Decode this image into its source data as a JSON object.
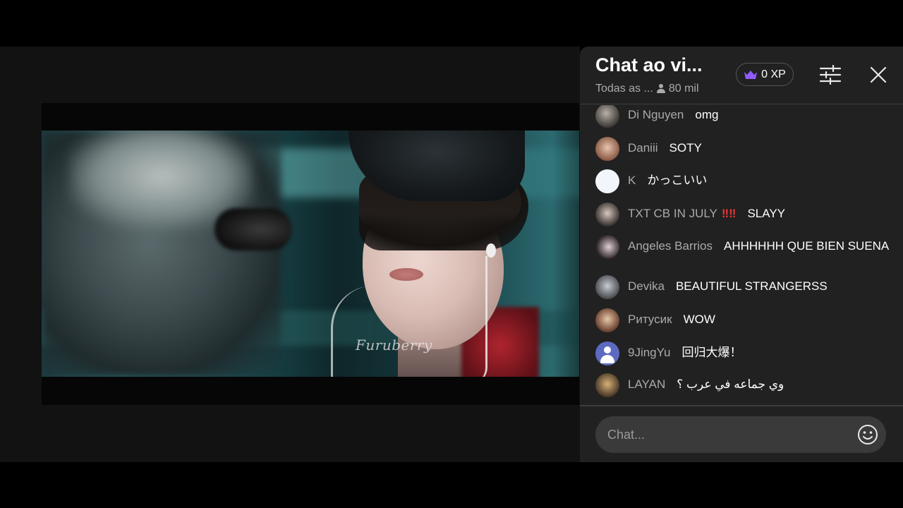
{
  "video": {
    "watermark": "Furuberry"
  },
  "chat": {
    "title": "Chat ao vi...",
    "filter_label": "Todas as ...",
    "viewer_count": "80 mil",
    "xp_label": "0 XP",
    "input_placeholder": "Chat...",
    "messages": [
      {
        "author": "Di Nguyen",
        "text": "omg"
      },
      {
        "author": "Daniii",
        "text": "SOTY"
      },
      {
        "author": "K",
        "text": "かっこいい"
      },
      {
        "author": "TXT CB IN JULY",
        "badge": "‼‼",
        "text": "SLAYY"
      },
      {
        "author": "Angeles Barrios",
        "text": "AHHHHHH QUE BIEN SUENA"
      },
      {
        "author": "Devika",
        "text": "BEAUTIFUL STRANGERSS"
      },
      {
        "author": "Ритусик",
        "text": "WOW"
      },
      {
        "author": "9JingYu",
        "text": "回归大爆！"
      },
      {
        "author": "LAYAN",
        "text": "وي جماعه في عرب ؟"
      }
    ]
  },
  "icons": {
    "crown": "crown-icon",
    "viewers": "person-icon",
    "filter": "sliders-icon",
    "close": "close-icon",
    "emoji": "smiley-icon"
  },
  "colors": {
    "panel_bg": "#212121",
    "crown": "#8e5cff",
    "muted_text": "#aaaaaa",
    "badge": "#e53935",
    "input_bg": "#3a3a3a"
  }
}
